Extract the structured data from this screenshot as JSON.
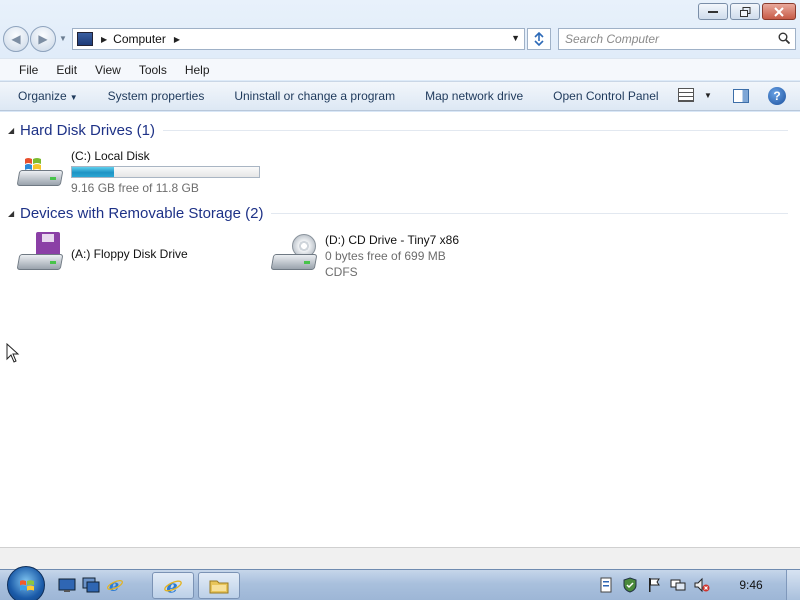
{
  "window": {
    "caption_buttons": [
      {
        "name": "minimize-button",
        "glyph": "▭"
      },
      {
        "name": "maximize-button",
        "glyph": "❐"
      },
      {
        "name": "close-button",
        "glyph": "✕"
      }
    ]
  },
  "address": {
    "location": "Computer",
    "location_icon": "computer-icon"
  },
  "search": {
    "placeholder": "Search Computer"
  },
  "menu": [
    "File",
    "Edit",
    "View",
    "Tools",
    "Help"
  ],
  "commands": {
    "organize": "Organize",
    "system_properties": "System properties",
    "uninstall": "Uninstall or change a program",
    "map_drive": "Map network drive",
    "control_panel": "Open Control Panel"
  },
  "groups": {
    "hard_disks": {
      "title": "Hard Disk Drives (1)",
      "drives": [
        {
          "name": "(C:) Local Disk",
          "free": "9.16 GB free of 11.8 GB",
          "used_fraction": 0.224
        }
      ]
    },
    "removable": {
      "title": "Devices with Removable Storage (2)",
      "drives": [
        {
          "name": "(A:) Floppy Disk Drive"
        },
        {
          "name": "(D:) CD Drive - Tiny7 x86",
          "free": "0 bytes free of 699 MB",
          "fs": "CDFS"
        }
      ]
    }
  },
  "taskbar": {
    "clock": "9:46",
    "quick_launch": [
      "show-desktop-icon",
      "switch-windows-icon",
      "internet-explorer-icon"
    ],
    "apps": [
      "internet-explorer-icon",
      "windows-explorer-icon"
    ],
    "tray": [
      "action-center-icon",
      "security-shield-icon",
      "flag-icon",
      "network-icon",
      "volume-muted-icon"
    ]
  },
  "colors": {
    "group_title": "#1e3287",
    "usage_fill": "#1e93c4",
    "command_text": "#1e395b"
  }
}
